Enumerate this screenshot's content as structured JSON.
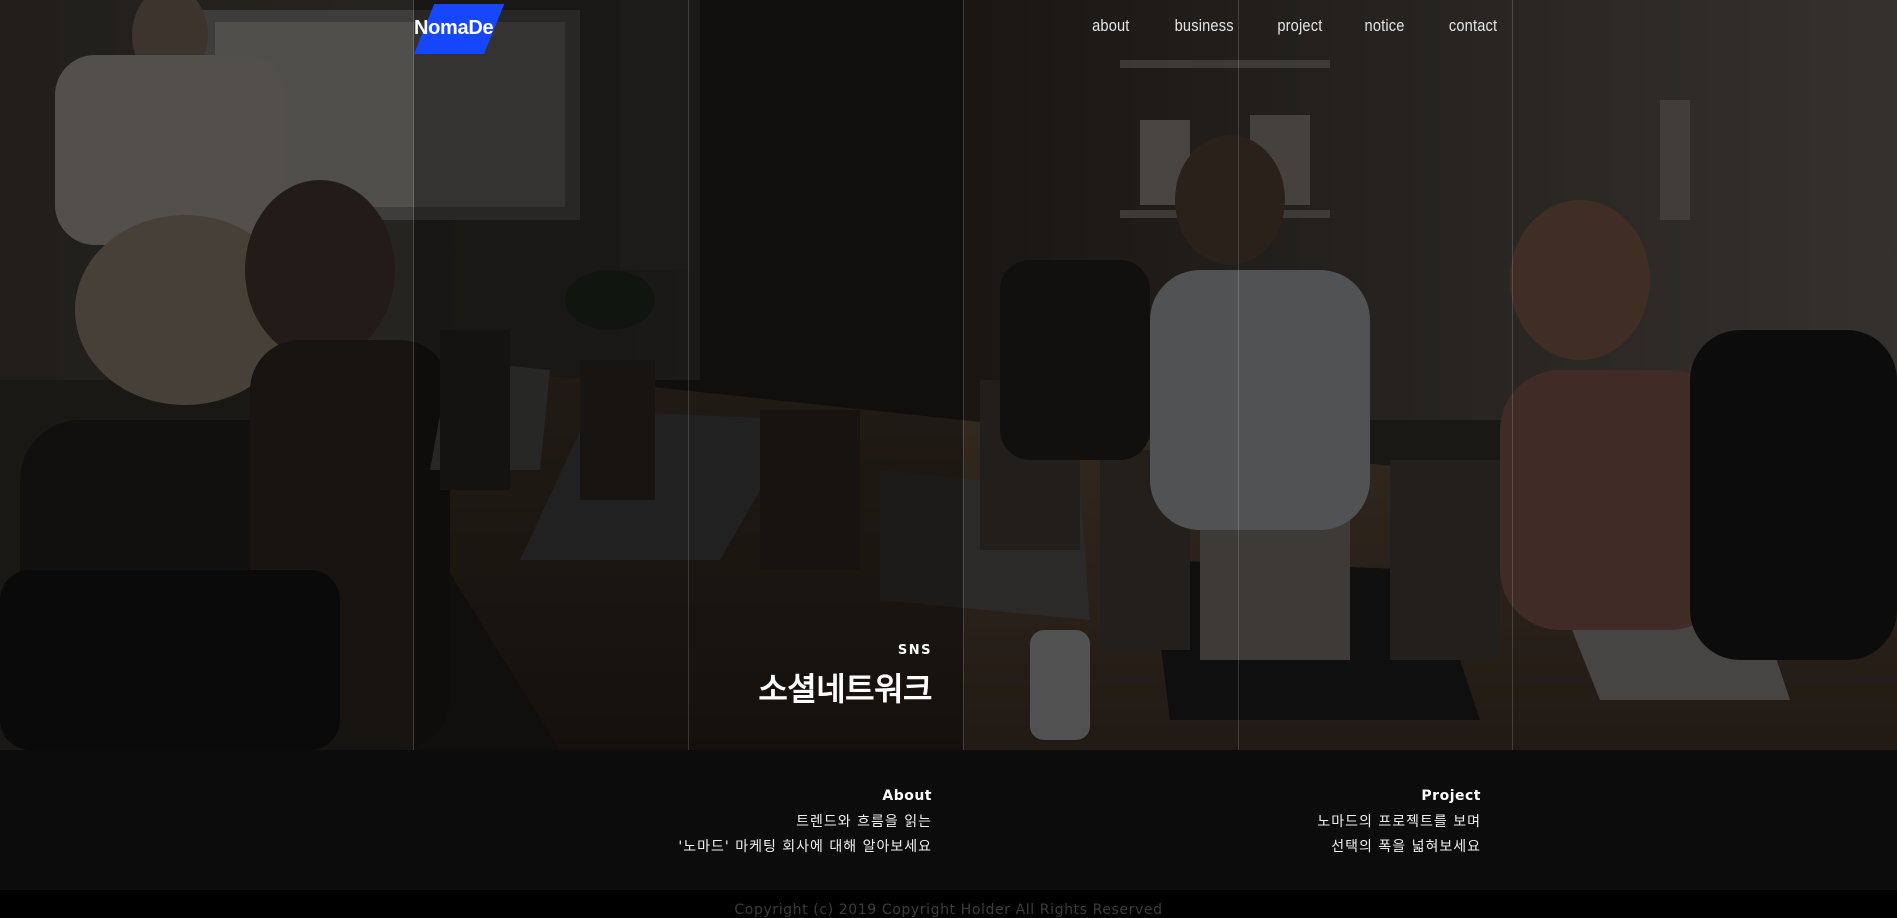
{
  "brand": {
    "logo_text": "NomaDe",
    "accent_color": "#1746ff"
  },
  "nav": {
    "items": [
      {
        "label": "about"
      },
      {
        "label": "business"
      },
      {
        "label": "project"
      },
      {
        "label": "notice"
      },
      {
        "label": "contact"
      }
    ]
  },
  "hero": {
    "kicker": "SNS",
    "title": "소셜네트워크"
  },
  "info": {
    "about": {
      "heading": "About",
      "lines": [
        "트렌드와 흐름을 읽는",
        "'노마드' 마케팅 회사에 대해 알아보세요"
      ]
    },
    "project": {
      "heading": "Project",
      "lines": [
        "노마드의 프로젝트를 보며",
        "선택의 폭을 넓혀보세요"
      ]
    }
  },
  "footer": {
    "copyright": "Copyright (c) 2019 Copyright Holder All Rights Reserved"
  }
}
